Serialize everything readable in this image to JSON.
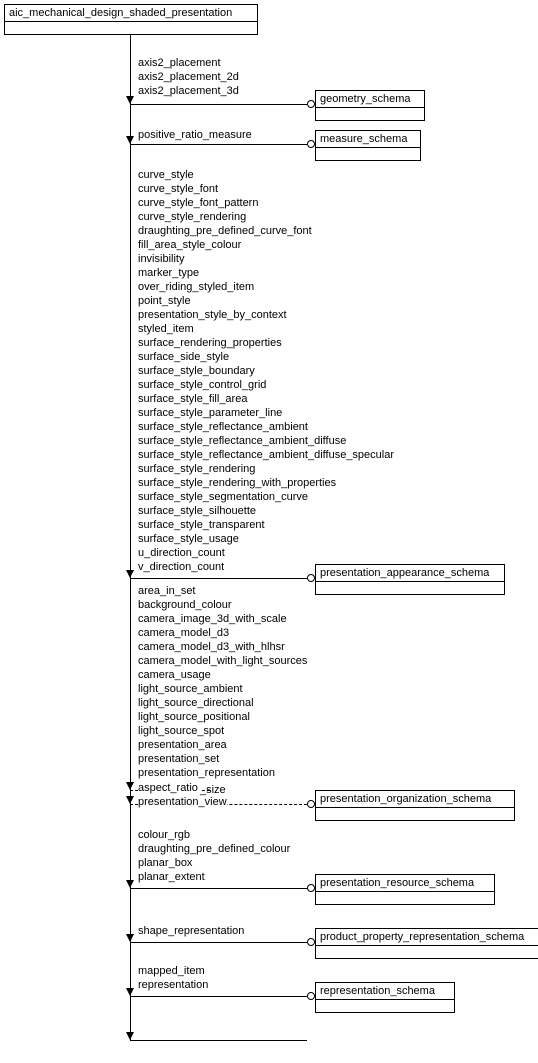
{
  "root": {
    "title": "aic_mechanical_design_shaded_presentation"
  },
  "groups": [
    {
      "items": [
        "axis2_placement",
        "axis2_placement_2d",
        "axis2_placement_3d"
      ],
      "target": "geometry_schema"
    },
    {
      "items": [
        "positive_ratio_measure"
      ],
      "target": "measure_schema"
    },
    {
      "items": [
        "curve_style",
        "curve_style_font",
        "curve_style_font_pattern",
        "curve_style_rendering",
        "draughting_pre_defined_curve_font",
        "fill_area_style_colour",
        "invisibility",
        "marker_type",
        "over_riding_styled_item",
        "point_style",
        "presentation_style_by_context",
        "styled_item",
        "surface_rendering_properties",
        "surface_side_style",
        "surface_style_boundary",
        "surface_style_control_grid",
        "surface_style_fill_area",
        "surface_style_parameter_line",
        "surface_style_reflectance_ambient",
        "surface_style_reflectance_ambient_diffuse",
        "surface_style_reflectance_ambient_diffuse_specular",
        "surface_style_rendering",
        "surface_style_rendering_with_properties",
        "surface_style_segmentation_curve",
        "surface_style_silhouette",
        "surface_style_transparent",
        "surface_style_usage",
        "u_direction_count",
        "v_direction_count"
      ],
      "target": "presentation_appearance_schema"
    },
    {
      "items": [
        "area_in_set",
        "background_colour",
        "camera_image_3d_with_scale",
        "camera_model_d3",
        "camera_model_d3_with_hlhsr",
        "camera_model_with_light_sources",
        "camera_usage",
        "light_source_ambient",
        "light_source_directional",
        "light_source_positional",
        "light_source_spot",
        "presentation_area",
        "presentation_set",
        "presentation_representation",
        "aspect_ratio",
        "presentation_size",
        "presentation_view"
      ],
      "target": "presentation_organization_schema"
    },
    {
      "items": [
        "colour_rgb",
        "draughting_pre_defined_colour",
        "planar_box",
        "planar_extent"
      ],
      "target": "presentation_resource_schema"
    },
    {
      "items": [
        "shape_representation"
      ],
      "target": "product_property_representation_schema"
    },
    {
      "items": [
        "mapped_item",
        "representation"
      ],
      "target": "representation_schema"
    }
  ]
}
